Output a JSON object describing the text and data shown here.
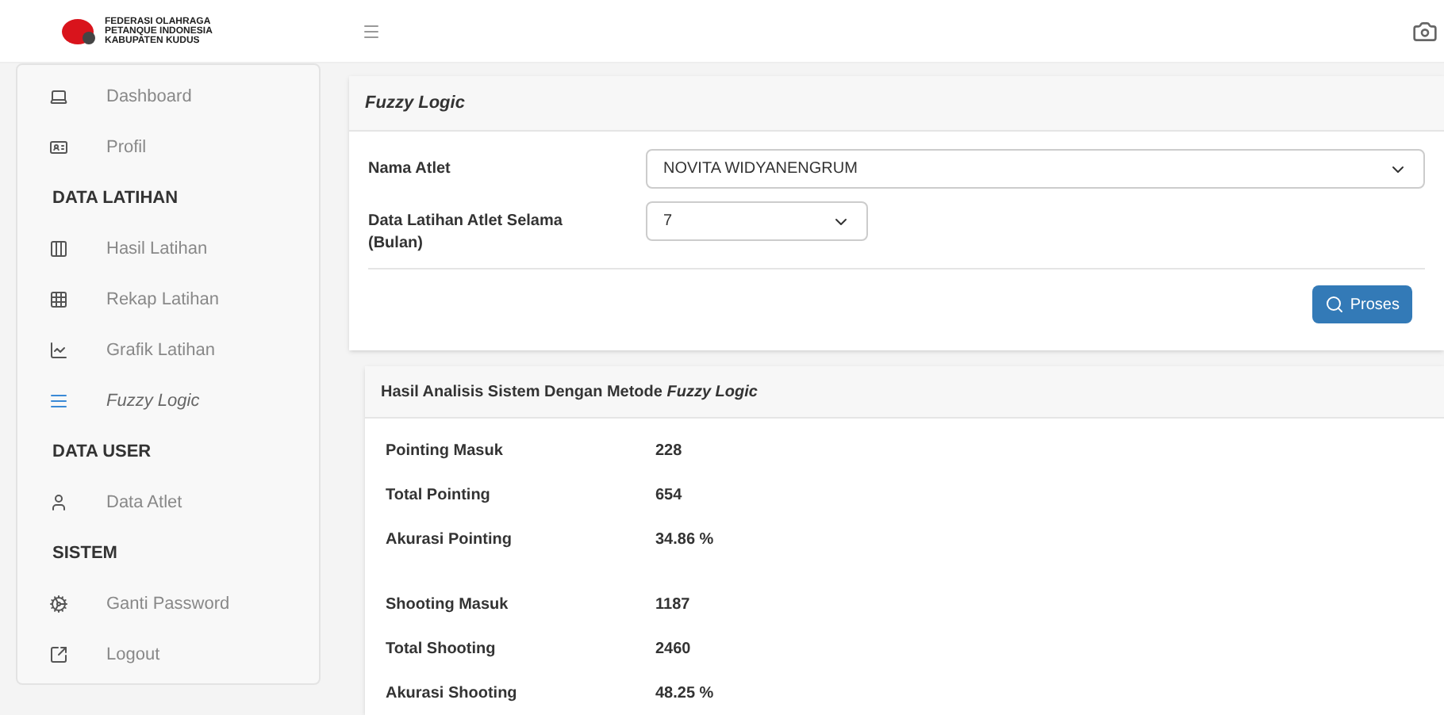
{
  "brand": {
    "lines": [
      "FEDERASI OLAHRAGA",
      "PETANQUE INDONESIA",
      "KABUPATEN KUDUS"
    ]
  },
  "sidebar": {
    "items": [
      {
        "kind": "link",
        "label": "Dashboard",
        "selected": false
      },
      {
        "kind": "link",
        "label": "Profil",
        "selected": false
      },
      {
        "kind": "heading",
        "label": "DATA LATIHAN"
      },
      {
        "kind": "link",
        "label": "Hasil Latihan",
        "selected": false
      },
      {
        "kind": "link",
        "label": "Rekap Latihan",
        "selected": false
      },
      {
        "kind": "link",
        "label": "Grafik Latihan",
        "selected": false
      },
      {
        "kind": "link",
        "label": "Fuzzy Logic",
        "selected": true
      },
      {
        "kind": "heading",
        "label": "DATA USER"
      },
      {
        "kind": "link",
        "label": "Data Atlet",
        "selected": false
      },
      {
        "kind": "heading",
        "label": "SISTEM"
      },
      {
        "kind": "link",
        "label": "Ganti Password",
        "selected": false
      },
      {
        "kind": "link",
        "label": "Logout",
        "selected": false
      }
    ]
  },
  "form_card": {
    "title": "Fuzzy Logic",
    "fields": [
      {
        "kind": "wide",
        "label": "Nama Atlet",
        "value": "NOVITA WIDYANENGRUM"
      },
      {
        "kind": "narrow",
        "label": "Data Latihan Atlet Selama (Bulan)",
        "value": "7"
      }
    ],
    "button": "Proses"
  },
  "result_card": {
    "title": "Hasil Analisis Sistem Dengan Metode *Fuzzy Logic*",
    "groups": [
      [
        {
          "label": "Pointing Masuk",
          "value": "228"
        },
        {
          "label": "Total Pointing",
          "value": "654"
        },
        {
          "label": "Akurasi Pointing",
          "value": "34.86 %"
        }
      ],
      [
        {
          "label": "Shooting Masuk",
          "value": "1187"
        },
        {
          "label": "Total Shooting",
          "value": "2460"
        },
        {
          "label": "Akurasi Shooting",
          "value": "48.25 %"
        }
      ]
    ]
  }
}
